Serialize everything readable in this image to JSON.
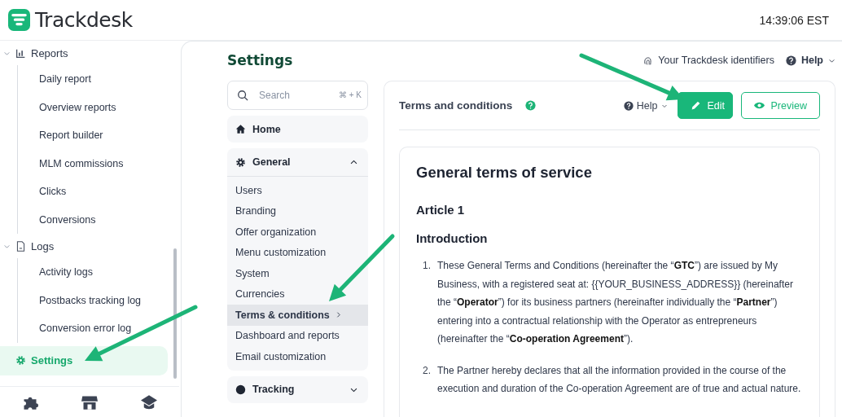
{
  "header": {
    "logo": "Trackdesk",
    "time": "14:39:06 EST"
  },
  "sidebar": {
    "items": [
      {
        "label": "Reports",
        "expanded": true,
        "selected": false,
        "children": [
          {
            "label": "Daily report",
            "selected": false
          },
          {
            "label": "Overview reports",
            "selected": false
          },
          {
            "label": "Report builder",
            "selected": false
          },
          {
            "label": "MLM commissions",
            "selected": false
          },
          {
            "label": "Clicks",
            "selected": false
          },
          {
            "label": "Conversions",
            "selected": false
          }
        ]
      },
      {
        "label": "Logs",
        "expanded": true,
        "selected": false,
        "children": [
          {
            "label": "Activity logs",
            "selected": false
          },
          {
            "label": "Postbacks tracking log",
            "selected": false
          },
          {
            "label": "Conversion error log",
            "selected": false
          }
        ]
      },
      {
        "label": "Settings",
        "selected": true
      }
    ]
  },
  "page_title": "Settings",
  "top_links": [
    {
      "label": "Your Trackdesk identifiers",
      "kind": "identifiers"
    },
    {
      "label": "Help",
      "kind": "help"
    }
  ],
  "settings_nav": {
    "search": {
      "placeholder": "Search",
      "shortcut": "⌘ + K"
    },
    "sections": [
      {
        "label": "Home"
      },
      {
        "label": "General",
        "expanded": true,
        "children": [
          {
            "label": "Users",
            "selected": false
          },
          {
            "label": "Branding",
            "selected": false
          },
          {
            "label": "Offer organization",
            "selected": false
          },
          {
            "label": "Menu customization",
            "selected": false
          },
          {
            "label": "System",
            "selected": false
          },
          {
            "label": "Currencies",
            "selected": false
          },
          {
            "label": "Terms & conditions",
            "selected": true
          },
          {
            "label": "Dashboard and reports",
            "selected": false
          },
          {
            "label": "Email customization",
            "selected": false
          }
        ]
      },
      {
        "label": "Tracking",
        "expanded": false
      }
    ]
  },
  "content": {
    "title": "Terms and conditions",
    "help": "Help",
    "buttons": [
      {
        "label": "Edit",
        "kind": "primary"
      },
      {
        "label": "Preview",
        "kind": "outline"
      }
    ],
    "document": {
      "heading": "General terms of service",
      "article": "Article 1",
      "section": "Introduction",
      "paragraphs": [
        {
          "number": "1.",
          "text": "These General Terms and Conditions (hereinafter the “**GTC**”) are issued by My Business, with a registered seat at: {{YOUR_BUSINESS_ADDRESS}} (hereinafter the “**Operator**”) for its business partners (hereinafter individually the “**Partner**”) entering into a contractual relationship with the Operator as entrepreneurs (hereinafter the “**Co-operation Agreement**”)."
        },
        {
          "number": "2.",
          "text": "The Partner hereby declares that all the information provided in the course of the execution and duration of the Co-operation Agreement are of true and actual nature."
        }
      ]
    }
  }
}
